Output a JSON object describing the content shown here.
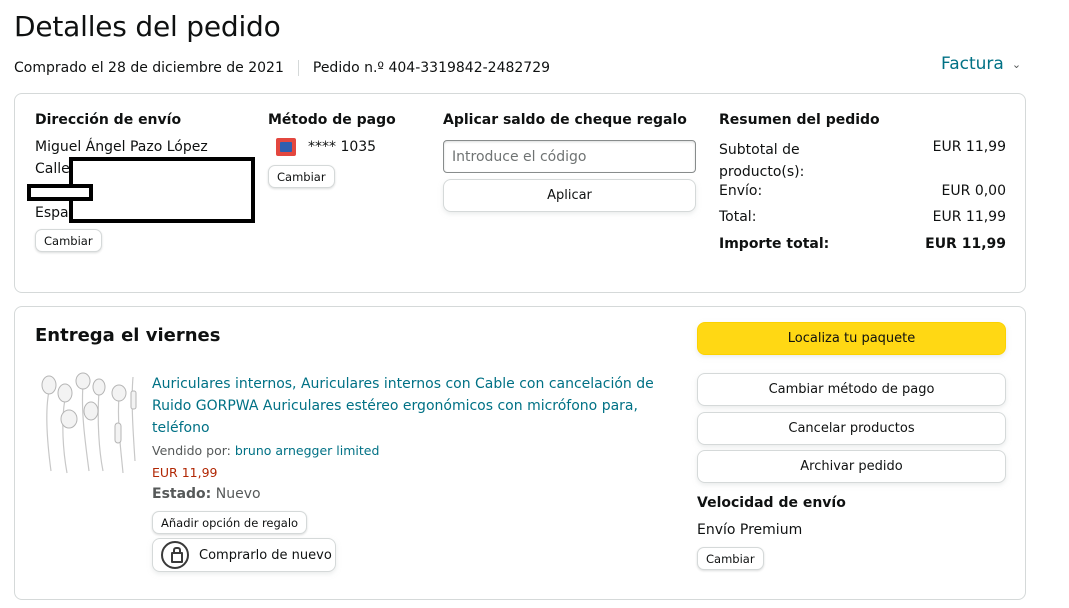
{
  "header": {
    "title": "Detalles del pedido",
    "purchased": "Comprado el 28 de diciembre de 2021",
    "order_number": "Pedido n.º 404-3319842-2482729",
    "invoice_label": "Factura"
  },
  "shipping": {
    "heading": "Dirección de envío",
    "name": "Miguel Ángel Pazo López",
    "line1": "Calle",
    "line3": "Espar",
    "change_label": "Cambiar"
  },
  "payment": {
    "heading": "Método de pago",
    "card_text": "**** 1035",
    "change_label": "Cambiar"
  },
  "gift": {
    "heading": "Aplicar saldo de cheque regalo",
    "placeholder": "Introduce el código",
    "apply_label": "Aplicar"
  },
  "summary": {
    "heading": "Resumen del pedido",
    "rows": [
      {
        "label": "Subtotal de",
        "label2": "producto(s):",
        "value": "EUR 11,99"
      },
      {
        "label": "Envío:",
        "value": "EUR 0,00"
      },
      {
        "label": "Total:",
        "value": "EUR 11,99"
      },
      {
        "label": "Importe total:",
        "value": "EUR 11,99"
      }
    ]
  },
  "delivery": {
    "heading": "Entrega el viernes",
    "product": {
      "title": "Auriculares internos, Auriculares internos con Cable con cancelación de Ruido GORPWA Auriculares estéreo ergonómicos con micrófono para, teléfono",
      "sold_by_label": "Vendido por:",
      "seller": "bruno arnegger limited",
      "price": "EUR 11,99",
      "status_label": "Estado:",
      "status_value": "Nuevo",
      "gift_option": "Añadir opción de regalo",
      "buy_again": "Comprarlo de nuevo"
    },
    "actions": {
      "track": "Localiza tu paquete",
      "change_payment": "Cambiar método de pago",
      "cancel": "Cancelar productos",
      "archive": "Archivar pedido"
    },
    "shipping_speed_heading": "Velocidad de envío",
    "shipping_speed_value": "Envío Premium",
    "change_label": "Cambiar"
  },
  "colors": {
    "link": "#007185",
    "price": "#b12704",
    "primary_button": "#ffd814",
    "border": "#d5d9d9"
  }
}
